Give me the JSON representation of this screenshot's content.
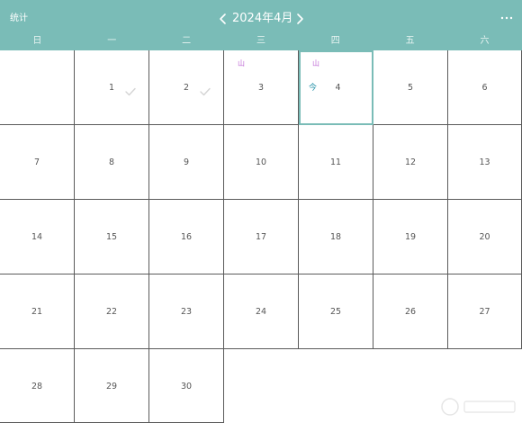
{
  "header": {
    "stats_label": "统计",
    "month_title": "2024年4月",
    "prev_icon": "chevron-left-icon",
    "next_icon": "chevron-right-icon",
    "more_icon": "more-horizontal-icon"
  },
  "weekdays": [
    "日",
    "一",
    "二",
    "三",
    "四",
    "五",
    "六"
  ],
  "calendar": {
    "first_weekday_offset": 1,
    "days": [
      {
        "day": "1",
        "checked": true
      },
      {
        "day": "2",
        "checked": true
      },
      {
        "day": "3",
        "mountain": "山"
      },
      {
        "day": "4",
        "mountain": "山",
        "today": true,
        "today_label": "今"
      },
      {
        "day": "5"
      },
      {
        "day": "6"
      },
      {
        "day": "7"
      },
      {
        "day": "8"
      },
      {
        "day": "9"
      },
      {
        "day": "10"
      },
      {
        "day": "11"
      },
      {
        "day": "12"
      },
      {
        "day": "13"
      },
      {
        "day": "14"
      },
      {
        "day": "15"
      },
      {
        "day": "16"
      },
      {
        "day": "17"
      },
      {
        "day": "18"
      },
      {
        "day": "19"
      },
      {
        "day": "20"
      },
      {
        "day": "21"
      },
      {
        "day": "22"
      },
      {
        "day": "23"
      },
      {
        "day": "24"
      },
      {
        "day": "25"
      },
      {
        "day": "26"
      },
      {
        "day": "27"
      },
      {
        "day": "28"
      },
      {
        "day": "29"
      },
      {
        "day": "30"
      }
    ]
  },
  "colors": {
    "header_bg": "#7abcb7",
    "today_border": "#7abcb7",
    "mountain": "#c06cd6",
    "today_label": "#1f8ea5",
    "check": "#d4d4d4",
    "grid_line": "#5a5a5a"
  }
}
